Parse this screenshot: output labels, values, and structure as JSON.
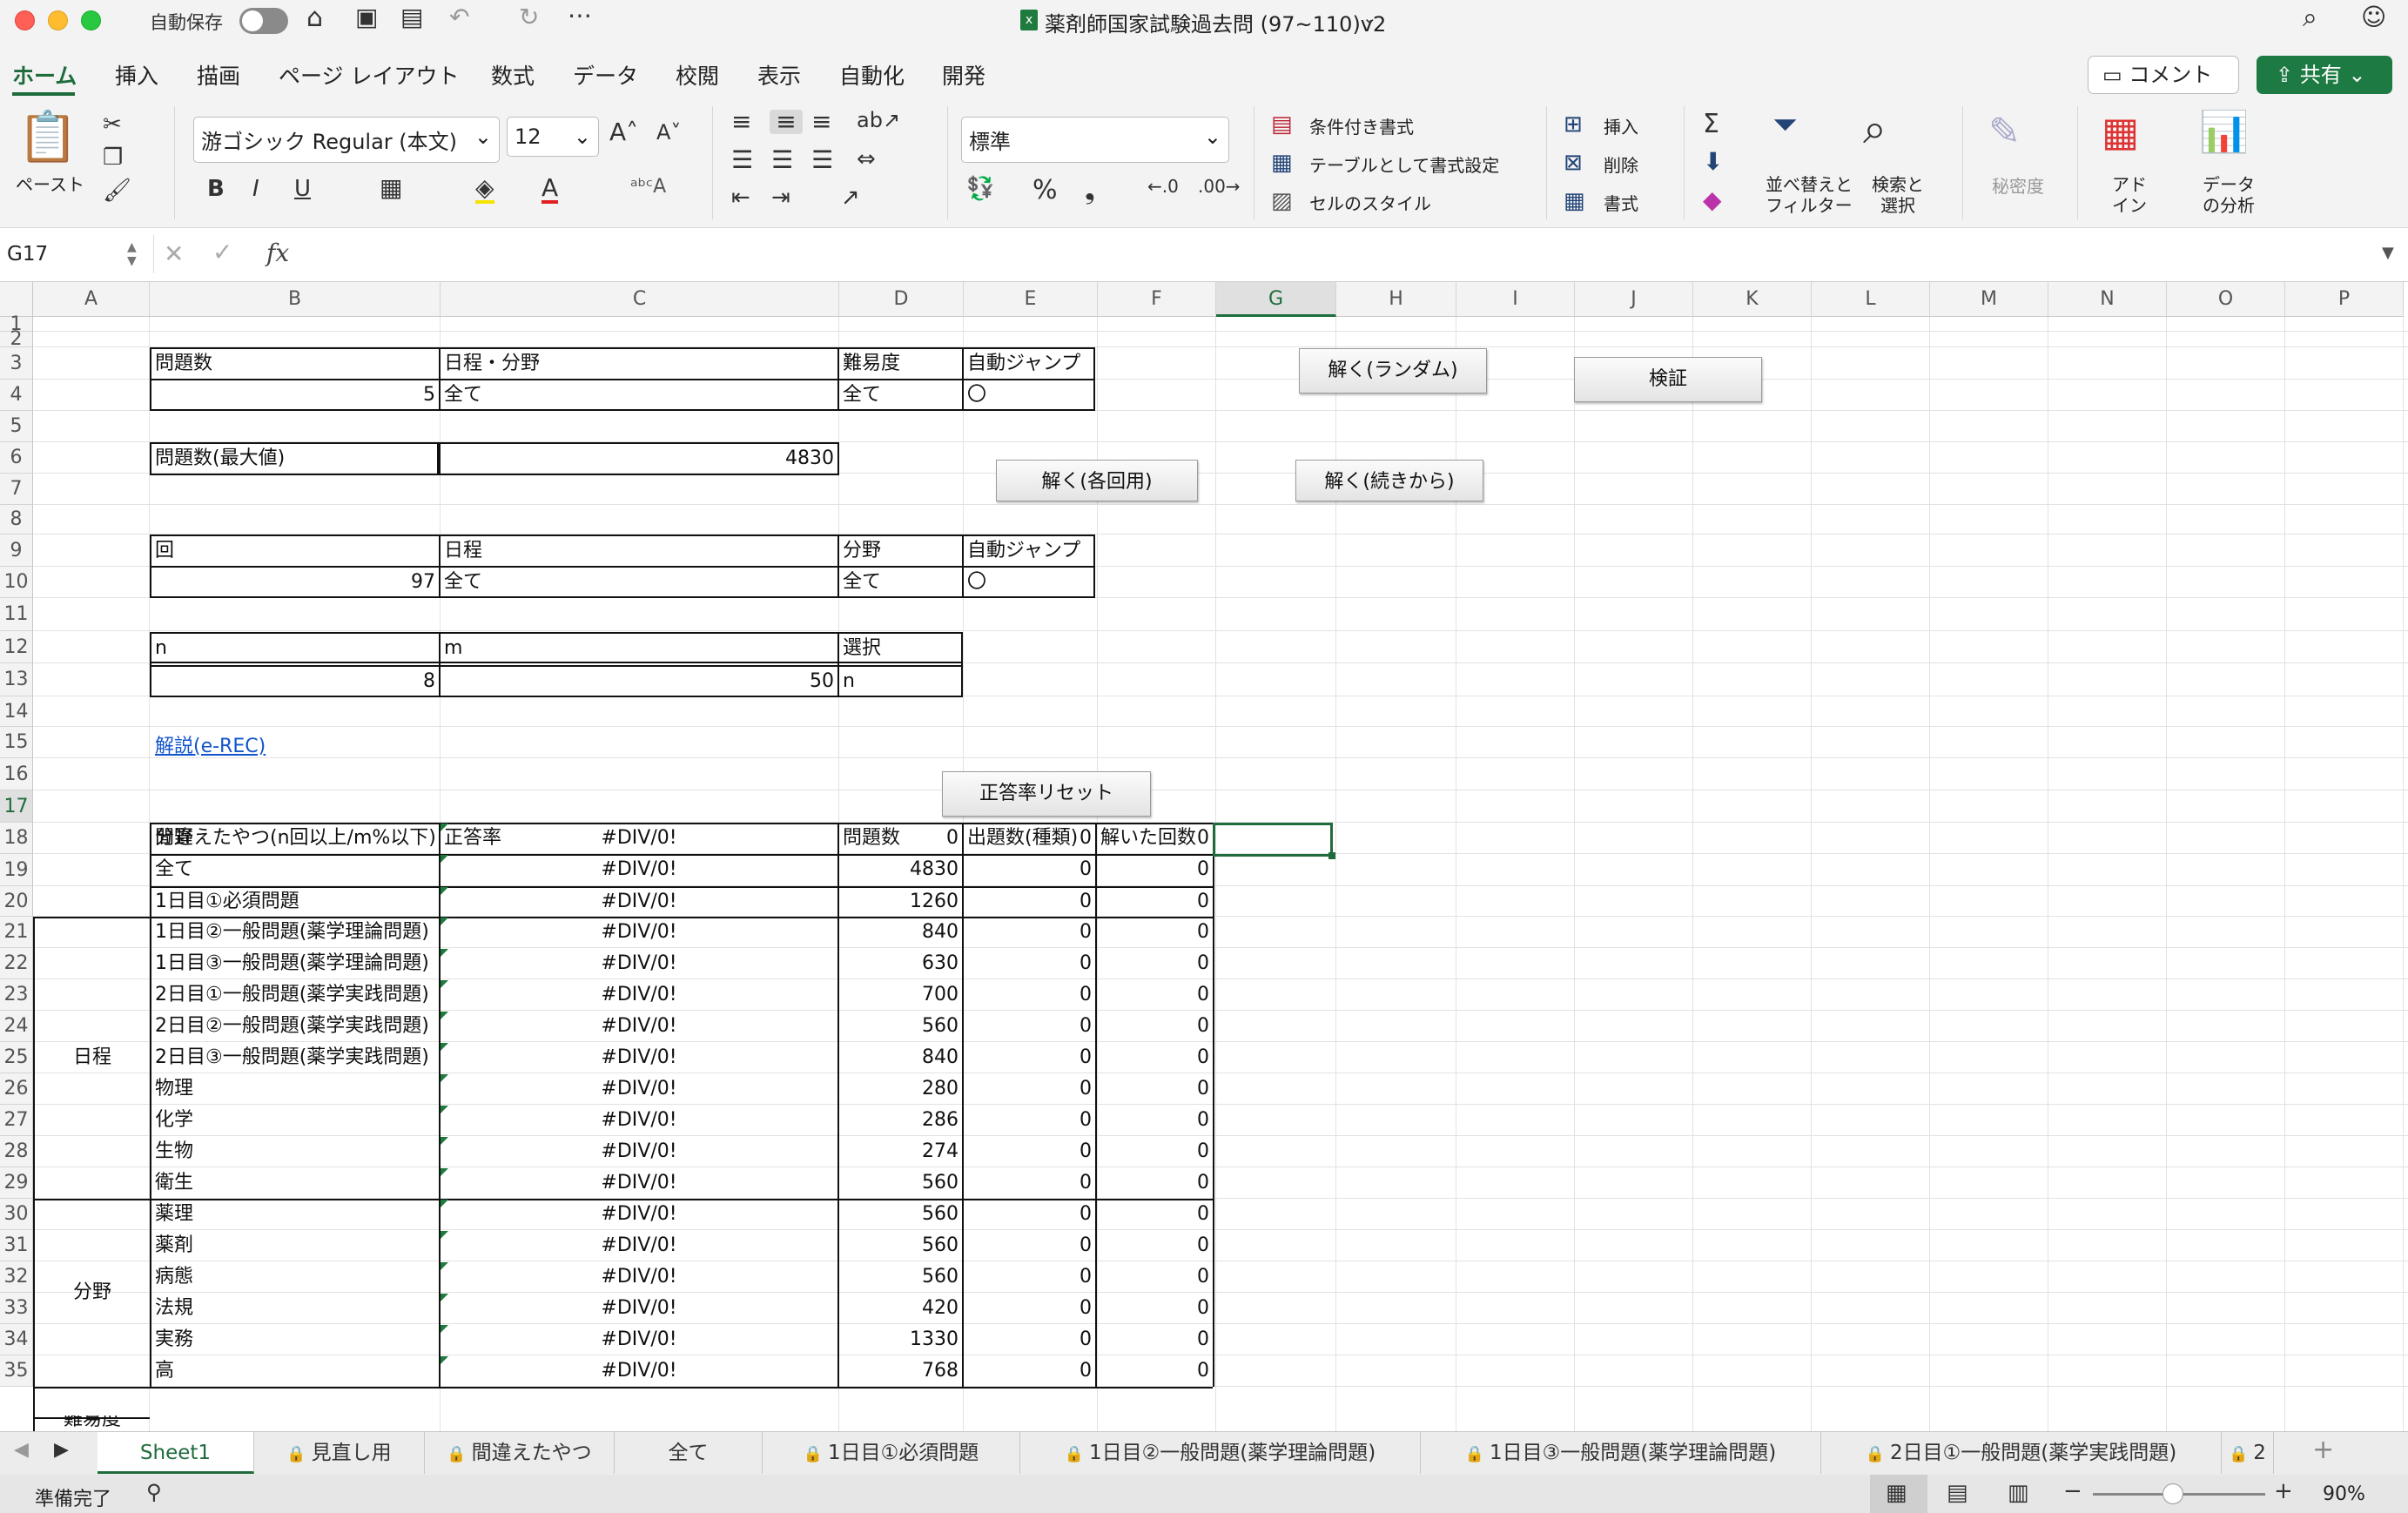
{
  "titlebar": {
    "autosave_label": "自動保存",
    "doc_title": "薬剤師国家試験過去問 (97~110)v2"
  },
  "ribbon_tabs": [
    "ホーム",
    "挿入",
    "描画",
    "ページ レイアウト",
    "数式",
    "データ",
    "校閲",
    "表示",
    "自動化",
    "開発"
  ],
  "actions": {
    "comment": "コメント",
    "share": "共有"
  },
  "ribbon": {
    "paste": "ペースト",
    "font_name": "游ゴシック Regular (本文)",
    "font_size": "12",
    "number_format": "標準",
    "cond_format": "条件付き書式",
    "table_format": "テーブルとして書式設定",
    "cell_style": "セルのスタイル",
    "insert": "挿入",
    "delete": "削除",
    "format": "書式",
    "sort_l1": "並べ替えと",
    "sort_l2": "フィルター",
    "find_l1": "検索と",
    "find_l2": "選択",
    "sensitivity": "秘密度",
    "addin_l1": "アド",
    "addin_l2": "イン",
    "analyze_l1": "データ",
    "analyze_l2": "の分析"
  },
  "formula_bar": {
    "name_box": "G17",
    "fx": "fx",
    "value": ""
  },
  "columns": [
    "A",
    "B",
    "C",
    "D",
    "E",
    "F",
    "G",
    "H",
    "I",
    "J",
    "K",
    "L",
    "M",
    "N",
    "O",
    "P"
  ],
  "rows": [
    "1",
    "2",
    "3",
    "4",
    "5",
    "6",
    "7",
    "8",
    "9",
    "10",
    "11",
    "12",
    "13",
    "14",
    "15",
    "16",
    "17",
    "18",
    "19",
    "20",
    "21",
    "22",
    "23",
    "24",
    "25",
    "26",
    "27",
    "28",
    "29",
    "30",
    "31",
    "32",
    "33",
    "34",
    "35"
  ],
  "block1": {
    "h_count": "問題数",
    "h_schedule": "日程・分野",
    "h_difficulty": "難易度",
    "h_autojump": "自動ジャンプ",
    "v_count": "5",
    "v_schedule": "全て",
    "v_difficulty": "全て",
    "v_autojump": "〇"
  },
  "block2": {
    "label": "問題数(最大値)",
    "value": "4830"
  },
  "block3": {
    "h_round": "回",
    "h_schedule": "日程",
    "h_field": "分野",
    "h_autojump": "自動ジャンプ",
    "v_round": "97",
    "v_schedule": "全て",
    "v_field": "全て",
    "v_autojump": "〇"
  },
  "block4": {
    "h_n": "n",
    "h_m": "m",
    "h_select": "選択",
    "v_n": "8",
    "v_m": "50",
    "v_select": "n"
  },
  "link": "解説(e-REC)",
  "buttons": {
    "random": "解く(ランダム)",
    "verify": "検証",
    "each": "解く(各回用)",
    "continue": "解く(続きから)",
    "reset": "正答率リセット"
  },
  "table": {
    "headers": [
      "分野",
      "正答率",
      "問題数",
      "出題数(種類)",
      "解いた回数"
    ],
    "group_schedule": "日程",
    "group_field": "分野",
    "group_partial": "難易度",
    "rows": [
      {
        "name": "間違えたやつ(n回以上/m%以下)",
        "rate": "#DIV/0!",
        "count": "0",
        "types": "0",
        "solved": "0"
      },
      {
        "name": "全て",
        "rate": "#DIV/0!",
        "count": "4830",
        "types": "0",
        "solved": "0"
      },
      {
        "name": "1日目①必須問題",
        "rate": "#DIV/0!",
        "count": "1260",
        "types": "0",
        "solved": "0"
      },
      {
        "name": "1日目②一般問題(薬学理論問題)",
        "rate": "#DIV/0!",
        "count": "840",
        "types": "0",
        "solved": "0"
      },
      {
        "name": "1日目③一般問題(薬学理論問題)",
        "rate": "#DIV/0!",
        "count": "630",
        "types": "0",
        "solved": "0"
      },
      {
        "name": "2日目①一般問題(薬学実践問題)",
        "rate": "#DIV/0!",
        "count": "700",
        "types": "0",
        "solved": "0"
      },
      {
        "name": "2日目②一般問題(薬学実践問題)",
        "rate": "#DIV/0!",
        "count": "560",
        "types": "0",
        "solved": "0"
      },
      {
        "name": "2日目③一般問題(薬学実践問題)",
        "rate": "#DIV/0!",
        "count": "840",
        "types": "0",
        "solved": "0"
      },
      {
        "name": "物理",
        "rate": "#DIV/0!",
        "count": "280",
        "types": "0",
        "solved": "0"
      },
      {
        "name": "化学",
        "rate": "#DIV/0!",
        "count": "286",
        "types": "0",
        "solved": "0"
      },
      {
        "name": "生物",
        "rate": "#DIV/0!",
        "count": "274",
        "types": "0",
        "solved": "0"
      },
      {
        "name": "衛生",
        "rate": "#DIV/0!",
        "count": "560",
        "types": "0",
        "solved": "0"
      },
      {
        "name": "薬理",
        "rate": "#DIV/0!",
        "count": "560",
        "types": "0",
        "solved": "0"
      },
      {
        "name": "薬剤",
        "rate": "#DIV/0!",
        "count": "560",
        "types": "0",
        "solved": "0"
      },
      {
        "name": "病態",
        "rate": "#DIV/0!",
        "count": "560",
        "types": "0",
        "solved": "0"
      },
      {
        "name": "法規",
        "rate": "#DIV/0!",
        "count": "420",
        "types": "0",
        "solved": "0"
      },
      {
        "name": "実務",
        "rate": "#DIV/0!",
        "count": "1330",
        "types": "0",
        "solved": "0"
      },
      {
        "name": "高",
        "rate": "#DIV/0!",
        "count": "768",
        "types": "0",
        "solved": "0"
      }
    ]
  },
  "sheet_tabs": [
    "Sheet1",
    "見直し用",
    "間違えたやつ",
    "全て",
    "1日目①必須問題",
    "1日目②一般問題(薬学理論問題)",
    "1日目③一般問題(薬学理論問題)",
    "2日目①一般問題(薬学実践問題)",
    "2"
  ],
  "status": {
    "ready": "準備完了",
    "zoom": "90%"
  }
}
